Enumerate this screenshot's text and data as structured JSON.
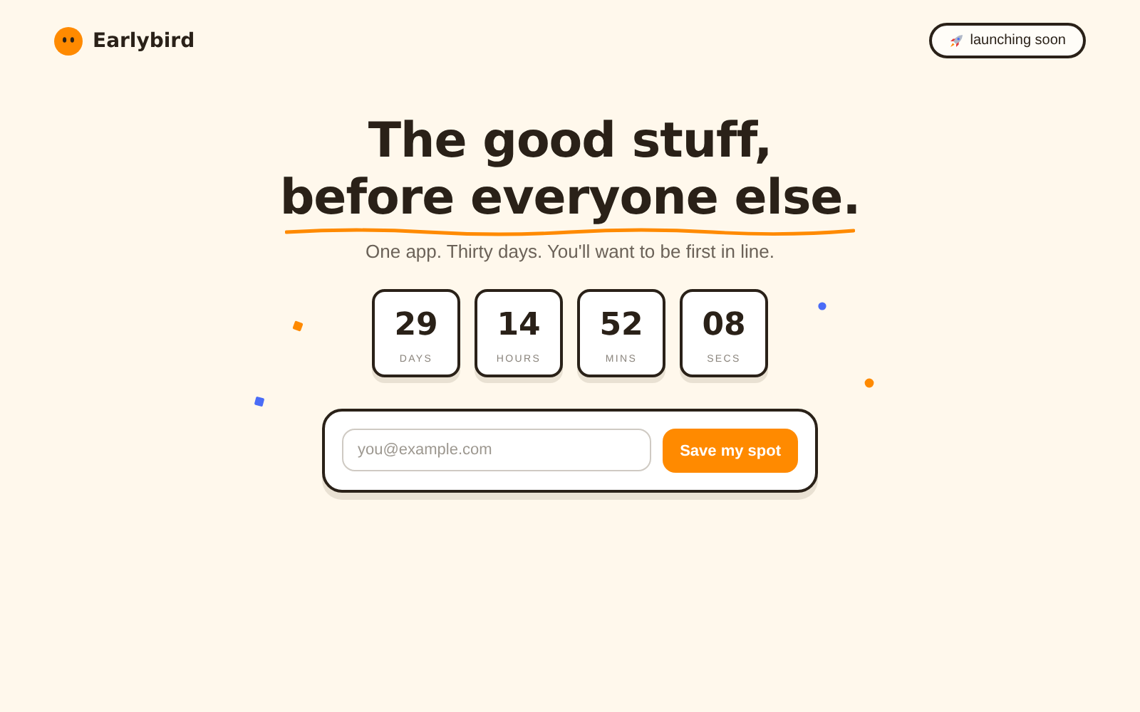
{
  "brand": {
    "name": "Earlybird"
  },
  "badge": {
    "label": "launching soon"
  },
  "headline": {
    "line_1": "The good stuff,",
    "line_2": "before everyone else."
  },
  "subtitle": "One app. Thirty days. You'll want to be first in line.",
  "countdown": [
    {
      "value": "29",
      "unit": "DAYS"
    },
    {
      "value": "14",
      "unit": "HOURS"
    },
    {
      "value": "52",
      "unit": "MINS"
    },
    {
      "value": "08",
      "unit": "SECS"
    }
  ],
  "signup": {
    "placeholder": "you@example.com",
    "button": "Save my spot"
  }
}
